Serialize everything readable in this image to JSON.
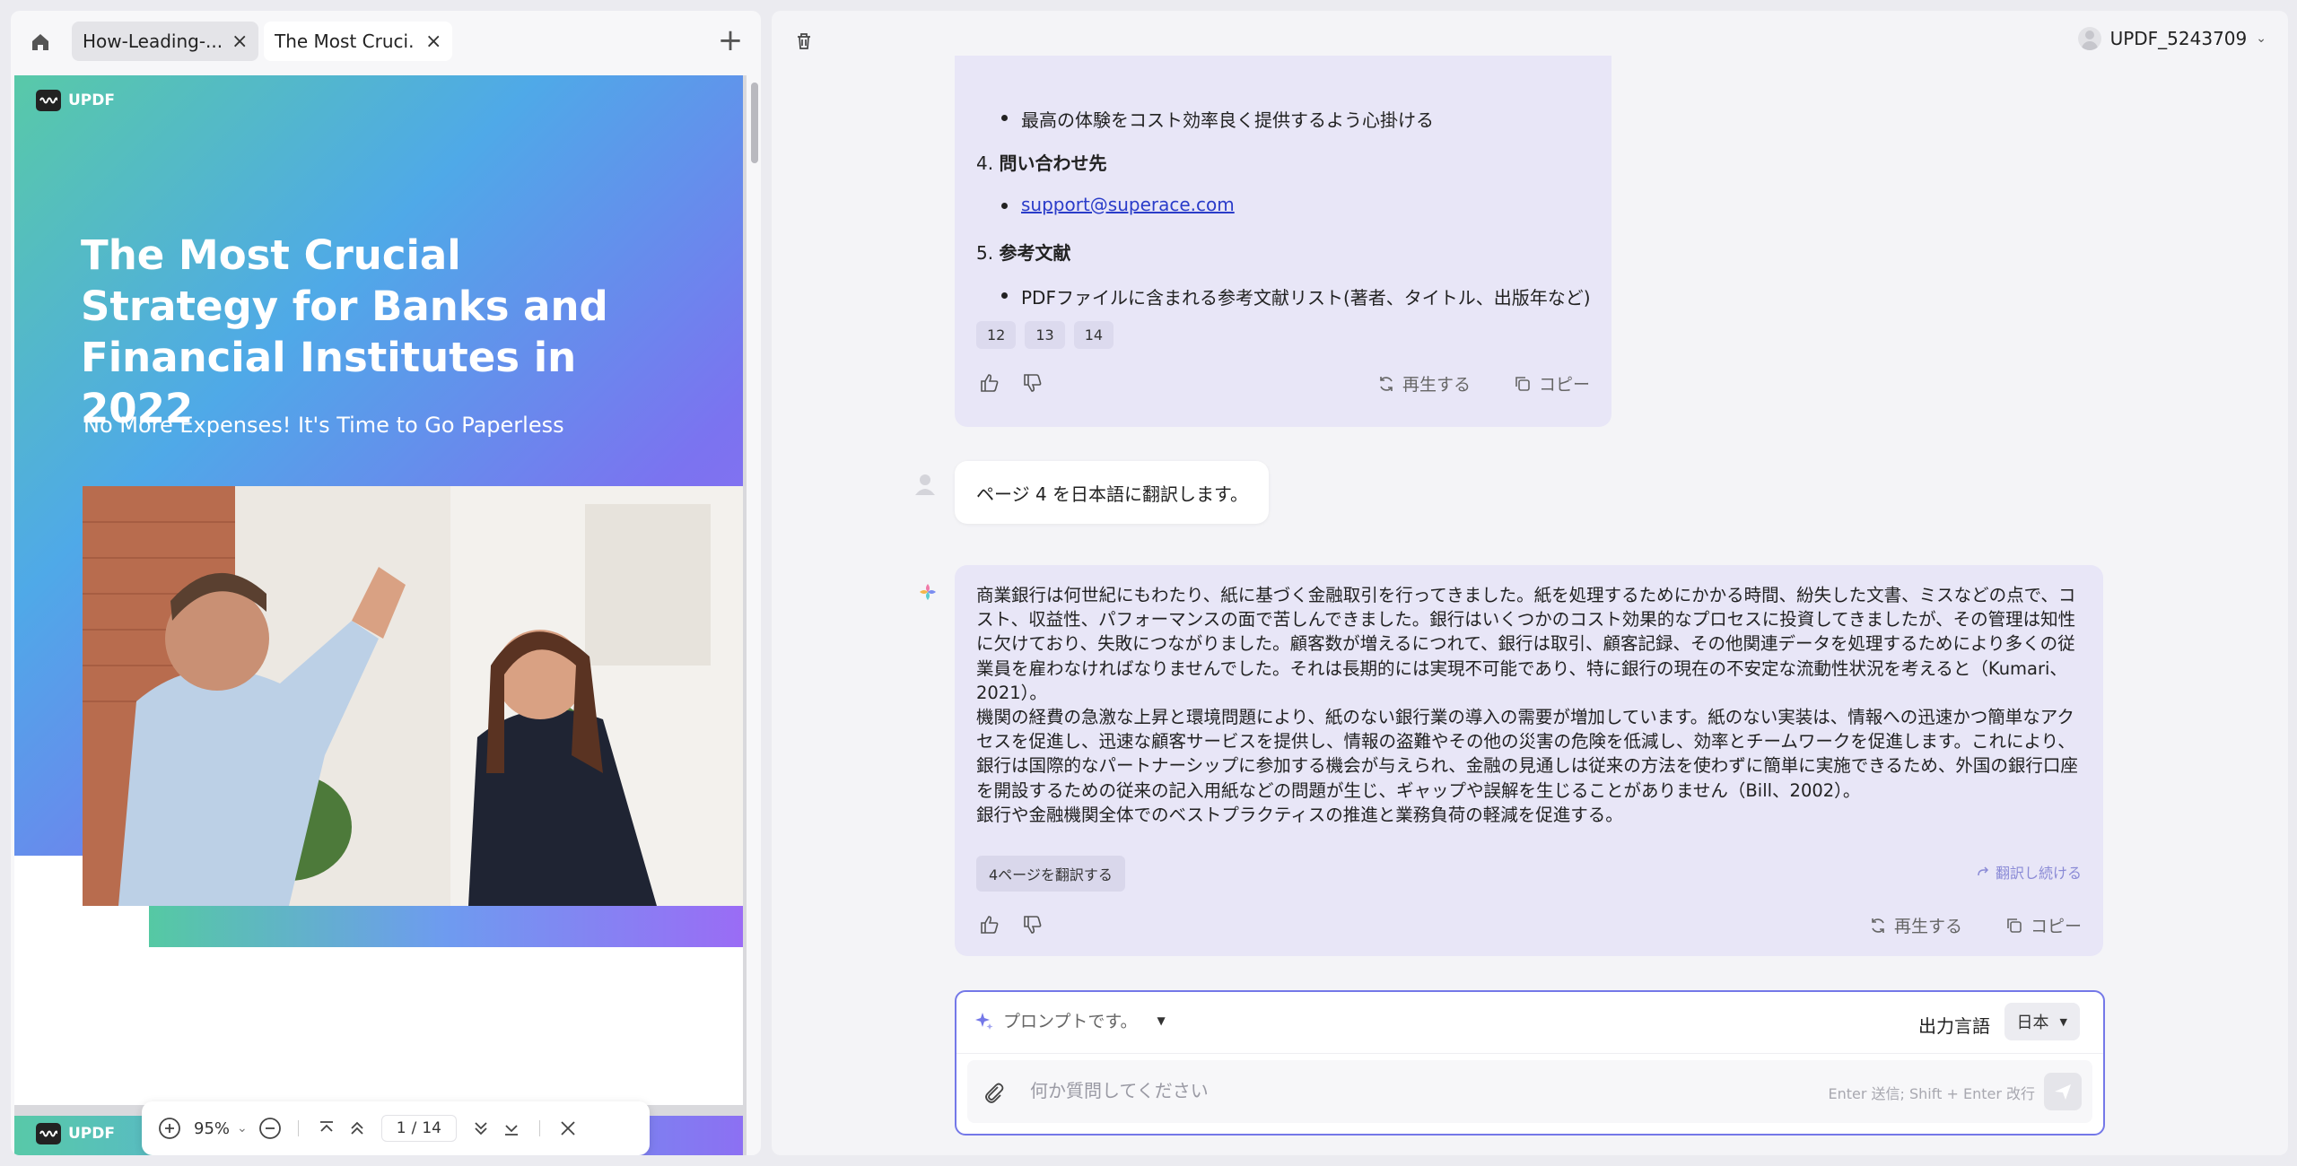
{
  "tabs": [
    {
      "label": "How-Leading-..."
    },
    {
      "label": "The Most Cruci..."
    }
  ],
  "pdf": {
    "logo_text": "UPDF",
    "title": "The Most Crucial Strategy for Banks and Financial Institutes in 2022",
    "subtitle": "No More Expenses! It's Time to Go Paperless",
    "page2_logo_text": "UPDF"
  },
  "zoom_toolbar": {
    "zoom": "95%",
    "current_page": "1",
    "separator": "/",
    "total_pages": "14"
  },
  "header": {
    "username": "UPDF_5243709"
  },
  "chat": {
    "message1": {
      "bullet_top": "最高の体験をコスト効率良く提供するよう心掛ける",
      "item4_num": "4.",
      "item4_title": "問い合わせ先",
      "item4_bullet": "support@superace.com",
      "item5_num": "5.",
      "item5_title": "参考文献",
      "item5_bullet": "PDFファイルに含まれる参考文献リスト(著者、タイトル、出版年など)",
      "refs": [
        "12",
        "13",
        "14"
      ],
      "regenerate": "再生する",
      "copy": "コピー"
    },
    "user_message": "ページ 4 を日本語に翻訳します。",
    "message2": {
      "paragraph1": "商業銀行は何世紀にもわたり、紙に基づく金融取引を行ってきました。紙を処理するためにかかる時間、紛失した文書、ミスなどの点で、コスト、収益性、パフォーマンスの面で苦しんできました。銀行はいくつかのコスト効果的なプロセスに投資してきましたが、その管理は知性に欠けており、失敗につながりました。顧客数が増えるにつれて、銀行は取引、顧客記録、その他関連データを処理するためにより多くの従業員を雇わなければなりませんでした。それは長期的には実現不可能であり、特に銀行の現在の不安定な流動性状況を考えると（Kumari、2021）。",
      "paragraph2": "機関の経費の急激な上昇と環境問題により、紙のない銀行業の導入の需要が増加しています。紙のない実装は、情報への迅速かつ簡単なアクセスを促進し、迅速な顧客サービスを提供し、情報の盗難やその他の災害の危険を低減し、効率とチームワークを促進します。これにより、銀行は国際的なパートナーシップに参加する機会が与えられ、金融の見通しは従来の方法を使わずに簡単に実施できるため、外国の銀行口座を開設するための従来の記入用紙などの問題が生じ、ギャップや誤解を生じることがありません（Bill、2002）。",
      "paragraph3": "銀行や金融機関全体でのベストプラクティスの推進と業務負荷の軽減を促進する。",
      "translate_page_button": "4ページを翻訳する",
      "continue_button": "翻訳し続ける",
      "regenerate": "再生する",
      "copy": "コピー"
    }
  },
  "composer": {
    "prompt_label": "プロンプトです。",
    "output_language_label": "出力言語",
    "language_value": "日本",
    "input_placeholder": "何か質問してください",
    "hint": "Enter 送信; Shift + Enter 改行"
  },
  "colors": {
    "accent": "#7478e8",
    "ai_bubble": "#e8e6f7",
    "link": "#2a3cc9"
  }
}
